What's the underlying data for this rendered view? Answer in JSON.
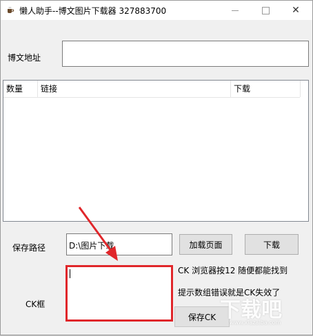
{
  "window": {
    "title": "懒人助手--博文图片下载器  327883700",
    "minimize_glyph": "—",
    "close_glyph": "✕"
  },
  "url_row": {
    "label": "博文地址",
    "value": ""
  },
  "list": {
    "columns": [
      "数量",
      "链接",
      "下载"
    ]
  },
  "save_row": {
    "label": "保存路径",
    "path_value": "D:\\图片下载",
    "load_button": "加载页面",
    "download_button": "下载"
  },
  "ck": {
    "label": "CK框",
    "value": "",
    "hint_1": "CK 浏览器按12 随便都能找到",
    "hint_2": "提示数组错误就是CK失效了",
    "save_button": "保存CK"
  },
  "watermark": {
    "text": "下载吧",
    "sub": "www.xiazaiba.com"
  },
  "colors": {
    "highlight": "#e0262a",
    "window_bg": "#f0f0f0"
  },
  "icons": {
    "app": "coffee-cup-icon"
  }
}
